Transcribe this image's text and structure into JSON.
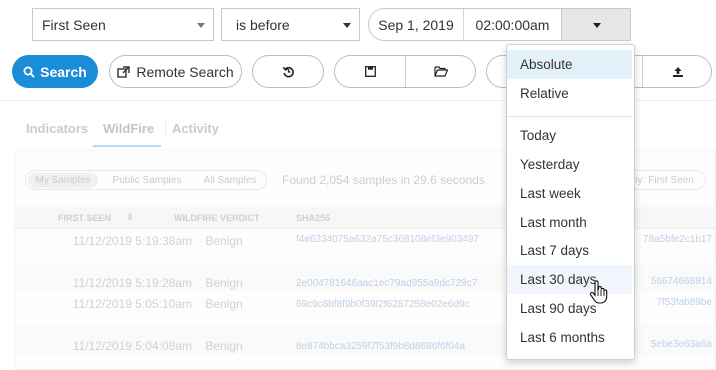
{
  "filter": {
    "field_value": "First Seen",
    "operator_value": "is before",
    "date_value": "Sep 1, 2019",
    "time_value": "02:00:00am"
  },
  "toolbar": {
    "search_label": "Search",
    "remote_search_label": "Remote Search"
  },
  "tabs": [
    "Indicators",
    "WildFire",
    "Activity"
  ],
  "sample_filters": [
    "My Samples",
    "Public Samples",
    "All Samples"
  ],
  "results_text": "Found 2,054 samples in 29.6 seconds",
  "sort_label": "Sort by: First Seen",
  "table": {
    "headers": [
      "FIRST SEEN",
      "WILDFIRE VERDICT",
      "SHA256"
    ],
    "rows": [
      {
        "first_seen": "11/12/2019 5:19:38am",
        "verdict": "Benign",
        "hash": "f4e6234075a632a75c368108ef3e903497",
        "hash_tail": "78a5bfe2c1b17"
      },
      {
        "first_seen": "11/12/2019 5:19:28am",
        "verdict": "Benign",
        "hash": "2e004781646aac1ec79ad955a9dc728c7",
        "hash_tail": "56674668914"
      },
      {
        "first_seen": "11/12/2019 5:05:10am",
        "verdict": "Benign",
        "hash": "69c9c8bf8f9b0f39f2f6287258e02e6d9c",
        "hash_tail": "7f53fab89be"
      },
      {
        "first_seen": "11/12/2019 5:04:08am",
        "verdict": "Benign",
        "hash": "8e874bbca3259f7f53f9b8d8686f6f04a",
        "hash_tail": "5ebe3e63a6a"
      }
    ]
  },
  "menu": {
    "section1": [
      "Absolute",
      "Relative"
    ],
    "section2": [
      "Today",
      "Yesterday",
      "Last week",
      "Last month",
      "Last 7 days",
      "Last 30 days",
      "Last 90 days",
      "Last 6 months"
    ],
    "selected": "Absolute",
    "hovered": "Last 30 days"
  },
  "colors": {
    "accent": "#1a8cd8",
    "selected_bg": "#e3f1fb",
    "hover_bg": "#f0f6fb"
  }
}
